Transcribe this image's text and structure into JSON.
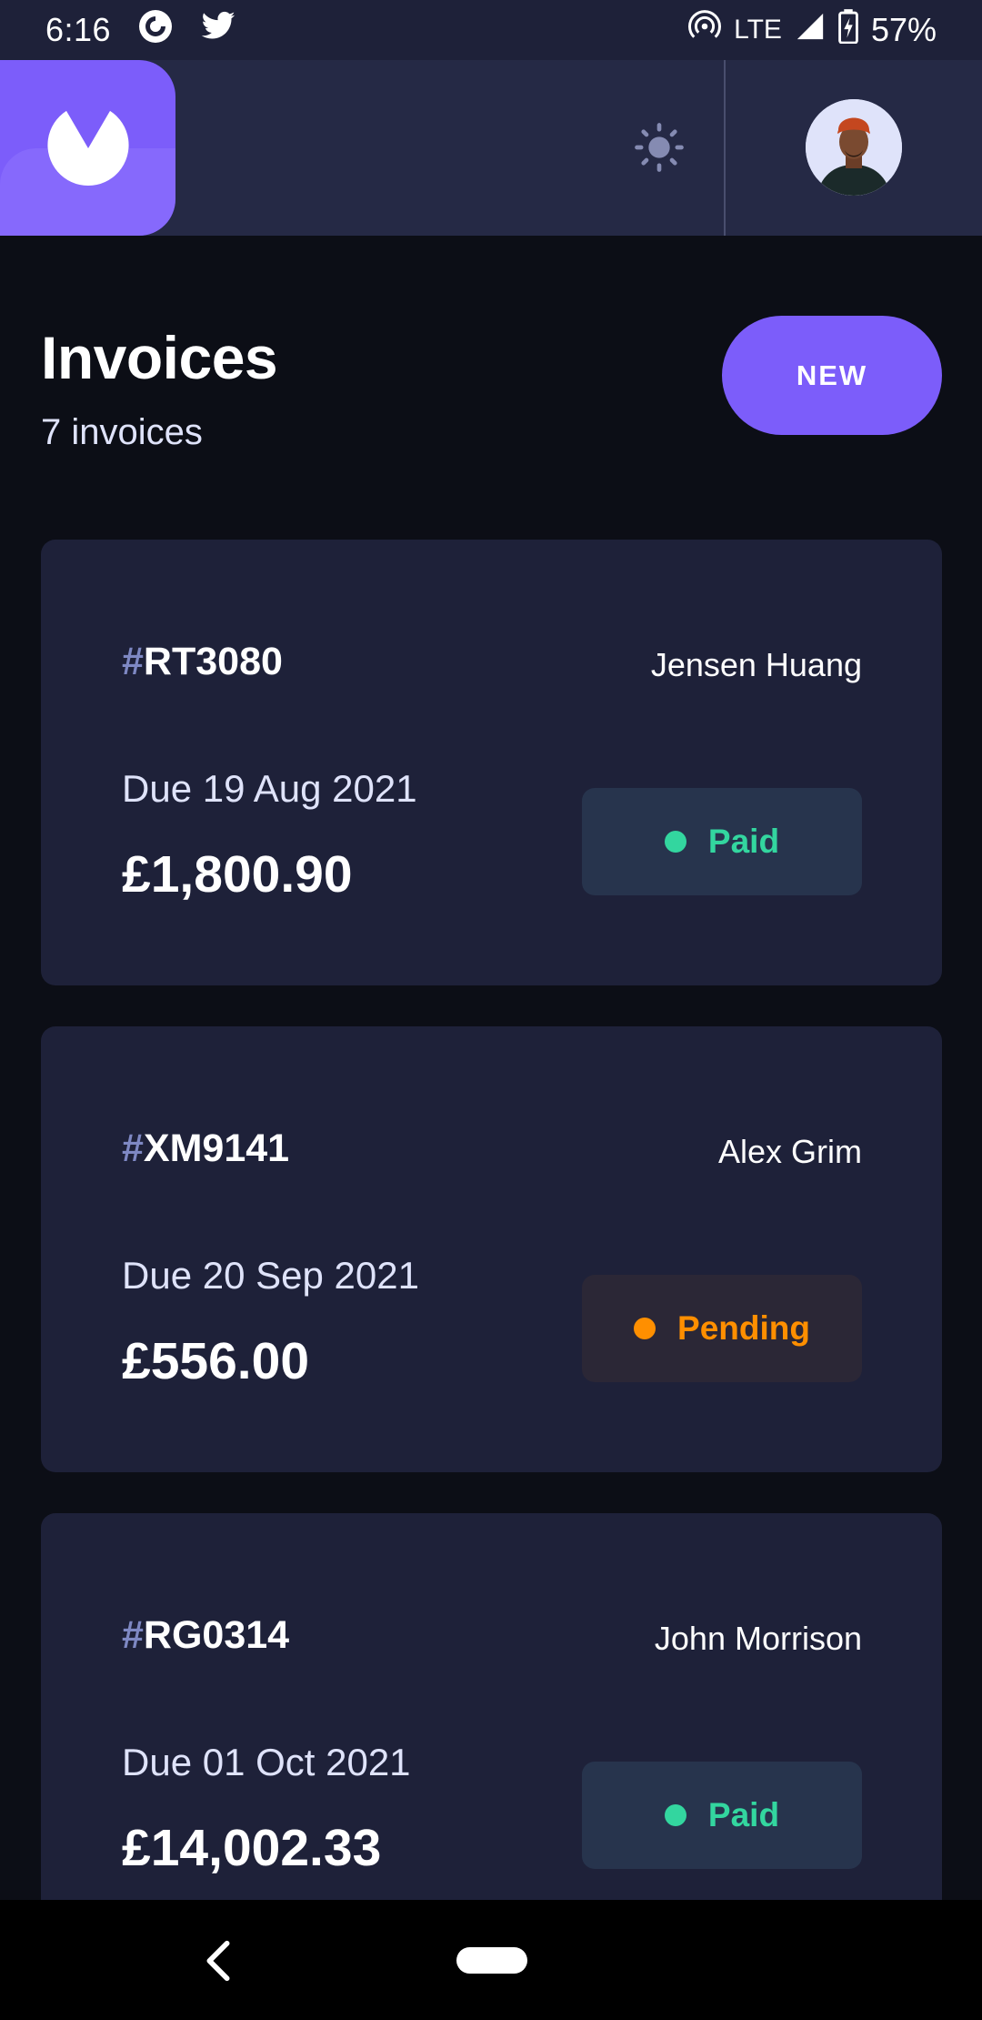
{
  "status_bar": {
    "time": "6:16",
    "network": "LTE",
    "battery": "57%",
    "battery_level": 0.57,
    "icons": [
      "pocketcasts-icon",
      "twitter-icon",
      "hotspot-icon",
      "signal-icon",
      "battery-charging-icon"
    ]
  },
  "header": {
    "logo_icon": "app-logo-icon",
    "theme_toggle_icon": "sun-icon",
    "avatar_icon": "user-avatar"
  },
  "page": {
    "title": "Invoices",
    "subtitle": "7 invoices",
    "new_button_label": "NEW"
  },
  "invoices": [
    {
      "hash": "#",
      "id": "RT3080",
      "client": "Jensen Huang",
      "due": "Due 19 Aug 2021",
      "amount": "£1,800.90",
      "status": "Paid"
    },
    {
      "hash": "#",
      "id": "XM9141",
      "client": "Alex Grim",
      "due": "Due 20 Sep 2021",
      "amount": "£556.00",
      "status": "Pending"
    },
    {
      "hash": "#",
      "id": "RG0314",
      "client": "John Morrison",
      "due": "Due 01 Oct 2021",
      "amount": "£14,002.33",
      "status": "Paid"
    }
  ],
  "colors": {
    "accent": "#7c5dfa",
    "paid": "#33d69f",
    "pending": "#ff8f00",
    "card": "#1e2139",
    "background": "#0c0e16"
  },
  "nav_bar": {
    "icons": [
      "back-icon",
      "home-pill-icon"
    ]
  }
}
